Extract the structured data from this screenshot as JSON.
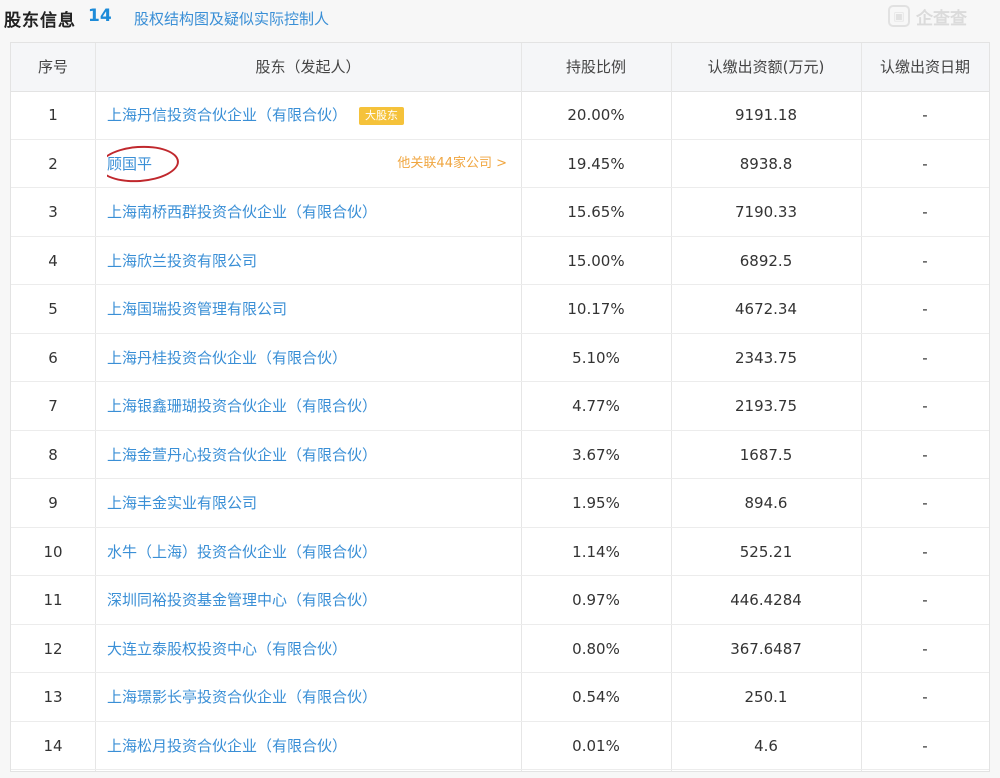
{
  "header": {
    "title": "股东信息",
    "count": "14",
    "link": "股权结构图及疑似实际控制人",
    "watermark_icon": "logo-icon",
    "watermark_text": "企查查"
  },
  "table": {
    "columns": [
      "序号",
      "股东（发起人）",
      "持股比例",
      "认缴出资额(万元)",
      "认缴出资日期"
    ],
    "rows": [
      {
        "idx": "1",
        "name": "上海丹信投资合伙企业（有限合伙）",
        "badge": "大股东",
        "ratio": "20.00%",
        "amount": "9191.18",
        "date": "-"
      },
      {
        "idx": "2",
        "name": "顾国平",
        "related": "他关联44家公司 >",
        "ratio": "19.45%",
        "amount": "8938.8",
        "date": "-"
      },
      {
        "idx": "3",
        "name": "上海南桥西群投资合伙企业（有限合伙）",
        "ratio": "15.65%",
        "amount": "7190.33",
        "date": "-"
      },
      {
        "idx": "4",
        "name": "上海欣兰投资有限公司",
        "ratio": "15.00%",
        "amount": "6892.5",
        "date": "-"
      },
      {
        "idx": "5",
        "name": "上海国瑞投资管理有限公司",
        "ratio": "10.17%",
        "amount": "4672.34",
        "date": "-"
      },
      {
        "idx": "6",
        "name": "上海丹桂投资合伙企业（有限合伙）",
        "ratio": "5.10%",
        "amount": "2343.75",
        "date": "-"
      },
      {
        "idx": "7",
        "name": "上海银鑫珊瑚投资合伙企业（有限合伙）",
        "ratio": "4.77%",
        "amount": "2193.75",
        "date": "-"
      },
      {
        "idx": "8",
        "name": "上海金萱丹心投资合伙企业（有限合伙）",
        "ratio": "3.67%",
        "amount": "1687.5",
        "date": "-"
      },
      {
        "idx": "9",
        "name": "上海丰金实业有限公司",
        "ratio": "1.95%",
        "amount": "894.6",
        "date": "-"
      },
      {
        "idx": "10",
        "name": "水牛（上海）投资合伙企业（有限合伙）",
        "ratio": "1.14%",
        "amount": "525.21",
        "date": "-"
      },
      {
        "idx": "11",
        "name": "深圳同裕投资基金管理中心（有限合伙）",
        "ratio": "0.97%",
        "amount": "446.4284",
        "date": "-"
      },
      {
        "idx": "12",
        "name": "大连立泰股权投资中心（有限合伙）",
        "ratio": "0.80%",
        "amount": "367.6487",
        "date": "-"
      },
      {
        "idx": "13",
        "name": "上海璟影长亭投资合伙企业（有限合伙）",
        "ratio": "0.54%",
        "amount": "250.1",
        "date": "-"
      },
      {
        "idx": "14",
        "name": "上海松月投资合伙企业（有限合伙）",
        "ratio": "0.01%",
        "amount": "4.6",
        "date": "-"
      }
    ]
  },
  "colors": {
    "link": "#3a8fd6",
    "count": "#1d8bd8",
    "badge_bg": "#f5c23a",
    "related_link": "#f0a640",
    "annotation_circle": "#c0282d"
  }
}
